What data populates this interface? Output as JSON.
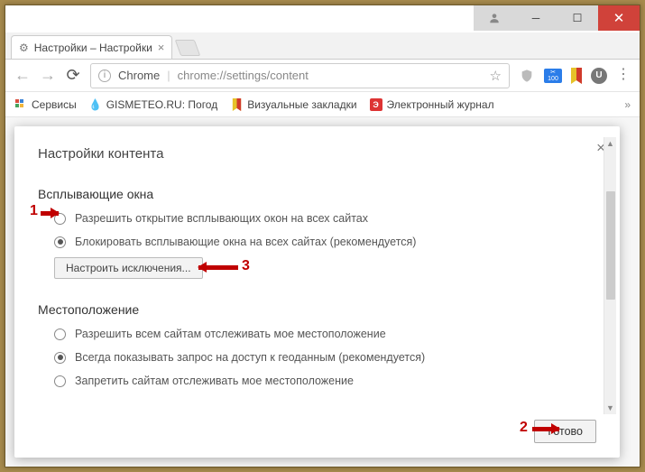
{
  "window": {
    "tab_title": "Настройки – Настройки",
    "chrome_label": "Chrome",
    "url": "chrome://settings/content"
  },
  "bookmarks": {
    "apps": "Сервисы",
    "gismeteo": "GISMETEO.RU: Погод",
    "visual": "Визуальные закладки",
    "journal": "Электронный журнал"
  },
  "dialog": {
    "title": "Настройки контента",
    "popup_section": "Всплывающие окна",
    "popup_allow": "Разрешить открытие всплывающих окон на всех сайтах",
    "popup_block": "Блокировать всплывающие окна на всех сайтах (рекомендуется)",
    "exceptions_btn": "Настроить исключения...",
    "location_section": "Местоположение",
    "loc_allow": "Разрешить всем сайтам отслеживать мое местоположение",
    "loc_ask": "Всегда показывать запрос на доступ к геоданным (рекомендуется)",
    "loc_block": "Запретить сайтам отслеживать мое местоположение",
    "done_btn": "Готово"
  },
  "annotations": {
    "one": "1",
    "two": "2",
    "three": "3"
  }
}
